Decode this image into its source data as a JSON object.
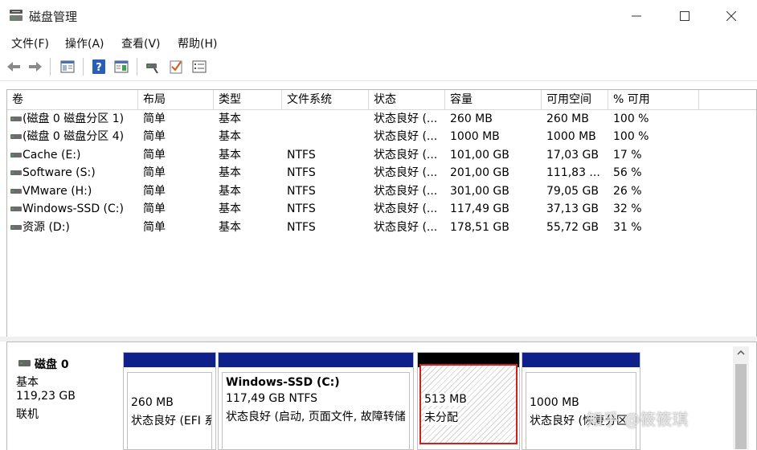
{
  "window": {
    "title": "磁盘管理",
    "controls": [
      "minimize-icon",
      "maximize-icon",
      "close-icon"
    ]
  },
  "menu": [
    {
      "label": "文件(F)"
    },
    {
      "label": "操作(A)"
    },
    {
      "label": "查看(V)"
    },
    {
      "label": "帮助(H)"
    }
  ],
  "toolbar": {
    "icons": [
      "back-arrow-icon",
      "forward-arrow-icon",
      "show-pane-icon",
      "help-icon",
      "properties-pane-icon",
      "connect-disk-icon",
      "check-icon",
      "list-icon"
    ]
  },
  "volume_table": {
    "columns": [
      "卷",
      "布局",
      "类型",
      "文件系统",
      "状态",
      "容量",
      "可用空间",
      "% 可用"
    ],
    "rows": [
      {
        "vol": "(磁盘 0 磁盘分区 1)",
        "layout": "简单",
        "type": "基本",
        "fs": "",
        "status": "状态良好 (...",
        "capacity": "260 MB",
        "free": "260 MB",
        "pct": "100 %"
      },
      {
        "vol": "(磁盘 0 磁盘分区 4)",
        "layout": "简单",
        "type": "基本",
        "fs": "",
        "status": "状态良好 (...",
        "capacity": "1000 MB",
        "free": "1000 MB",
        "pct": "100 %"
      },
      {
        "vol": "Cache (E:)",
        "layout": "简单",
        "type": "基本",
        "fs": "NTFS",
        "status": "状态良好 (...",
        "capacity": "101,00 GB",
        "free": "17,03 GB",
        "pct": "17 %"
      },
      {
        "vol": "Software (S:)",
        "layout": "简单",
        "type": "基本",
        "fs": "NTFS",
        "status": "状态良好 (...",
        "capacity": "201,00 GB",
        "free": "111,83 ...",
        "pct": "56 %"
      },
      {
        "vol": "VMware (H:)",
        "layout": "简单",
        "type": "基本",
        "fs": "NTFS",
        "status": "状态良好 (...",
        "capacity": "301,00 GB",
        "free": "79,05 GB",
        "pct": "26 %"
      },
      {
        "vol": "Windows-SSD (C:)",
        "layout": "简单",
        "type": "基本",
        "fs": "NTFS",
        "status": "状态良好 (...",
        "capacity": "117,49 GB",
        "free": "37,13 GB",
        "pct": "32 %"
      },
      {
        "vol": "资源 (D:)",
        "layout": "简单",
        "type": "基本",
        "fs": "NTFS",
        "status": "状态良好 (...",
        "capacity": "178,51 GB",
        "free": "55,72 GB",
        "pct": "31 %"
      }
    ]
  },
  "disk": {
    "name": "磁盘 0",
    "type": "基本",
    "size": "119,23 GB",
    "state": "联机",
    "partitions": [
      {
        "name": "",
        "size": "260 MB",
        "status": "状态良好 (EFI 系",
        "bar": "primary"
      },
      {
        "name": "Windows-SSD  (C:)",
        "size": "117,49 GB NTFS",
        "status": "状态良好 (启动, 页面文件, 故障转储",
        "bar": "primary"
      },
      {
        "name": "",
        "size": "513 MB",
        "status": "未分配",
        "bar": "unallocated",
        "selected": true
      },
      {
        "name": "",
        "size": "1000 MB",
        "status": "状态良好 (恢复分区",
        "bar": "primary"
      }
    ]
  },
  "watermark": "知乎 @筱筱琪",
  "colors": {
    "primary_partition": "#10208a",
    "unallocated": "#000000",
    "selection": "#d0201b"
  }
}
